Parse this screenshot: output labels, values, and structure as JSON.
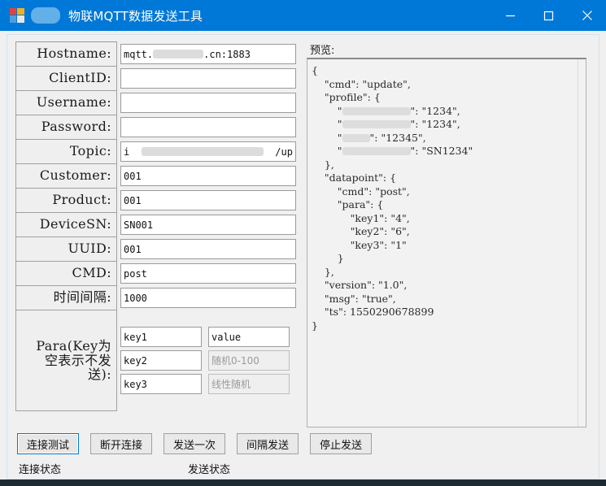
{
  "window": {
    "title": "物联MQTT数据发送工具",
    "icon": "app-grid-icon",
    "title_redaction": true,
    "accent_color": "#0078d7",
    "client_bg": "#f0f0f0",
    "caption": {
      "minimize": "minimize-icon",
      "maximize": "maximize-icon",
      "close": "close-icon"
    }
  },
  "form": {
    "rows": [
      {
        "label": "Hostname:",
        "value_prefix": "mqtt.",
        "value_suffix": ".cn:1883",
        "redacted": true,
        "placeholder": ""
      },
      {
        "label": "ClientID:",
        "value": "",
        "placeholder": ""
      },
      {
        "label": "Username:",
        "value": "",
        "placeholder": ""
      },
      {
        "label": "Password:",
        "value": "",
        "placeholder": ""
      },
      {
        "label": "Topic:",
        "value_prefix": "i",
        "value_suffix": "/up",
        "redacted": true,
        "placeholder": ""
      },
      {
        "label": "Customer:",
        "value": "001",
        "placeholder": ""
      },
      {
        "label": "Product:",
        "value": "001",
        "placeholder": ""
      },
      {
        "label": "DeviceSN:",
        "value": "SN001",
        "placeholder": ""
      },
      {
        "label": "UUID:",
        "value": "001",
        "placeholder": ""
      },
      {
        "label": "CMD:",
        "value": "post",
        "placeholder": ""
      },
      {
        "label": "时间间隔:",
        "value": "1000",
        "placeholder": ""
      }
    ],
    "para": {
      "label_lines": [
        "Para(Key为",
        "空表示不发",
        "送):"
      ],
      "rows": [
        {
          "key": "key1",
          "value": "value",
          "value_disabled": false
        },
        {
          "key": "key2",
          "value": "随机0-100",
          "value_disabled": true
        },
        {
          "key": "key3",
          "value": "线性随机",
          "value_disabled": true
        }
      ]
    }
  },
  "preview": {
    "label": "预览:",
    "lines": [
      {
        "text": "{"
      },
      {
        "text": "    \"cmd\": \"update\","
      },
      {
        "text": "    \"profile\": {"
      },
      {
        "pre": "        \"",
        "redact_width": 84,
        "post": "\": \"1234\","
      },
      {
        "pre": "        \"",
        "redact_width": 84,
        "post": "\": \"1234\","
      },
      {
        "pre": "        \"",
        "redact_width": 34,
        "post": "\": \"12345\","
      },
      {
        "pre": "        \"",
        "redact_width": 84,
        "post": "\": \"SN1234\""
      },
      {
        "text": "    },"
      },
      {
        "text": "    \"datapoint\": {"
      },
      {
        "text": "        \"cmd\": \"post\","
      },
      {
        "text": "        \"para\": {"
      },
      {
        "text": "            \"key1\": \"4\","
      },
      {
        "text": "            \"key2\": \"6\","
      },
      {
        "text": "            \"key3\": \"1\""
      },
      {
        "text": "        }"
      },
      {
        "text": "    },"
      },
      {
        "text": "    \"version\": \"1.0\","
      },
      {
        "text": "    \"msg\": \"true\","
      },
      {
        "text": "    \"ts\": 1550290678899"
      },
      {
        "text": "}"
      }
    ]
  },
  "buttons": [
    {
      "label": "连接测试",
      "focused": true
    },
    {
      "label": "断开连接",
      "focused": false
    },
    {
      "label": "发送一次",
      "focused": false
    },
    {
      "label": "间隔发送",
      "focused": false
    },
    {
      "label": "停止发送",
      "focused": false
    }
  ],
  "status": {
    "connection": "连接状态",
    "send": "发送状态"
  }
}
